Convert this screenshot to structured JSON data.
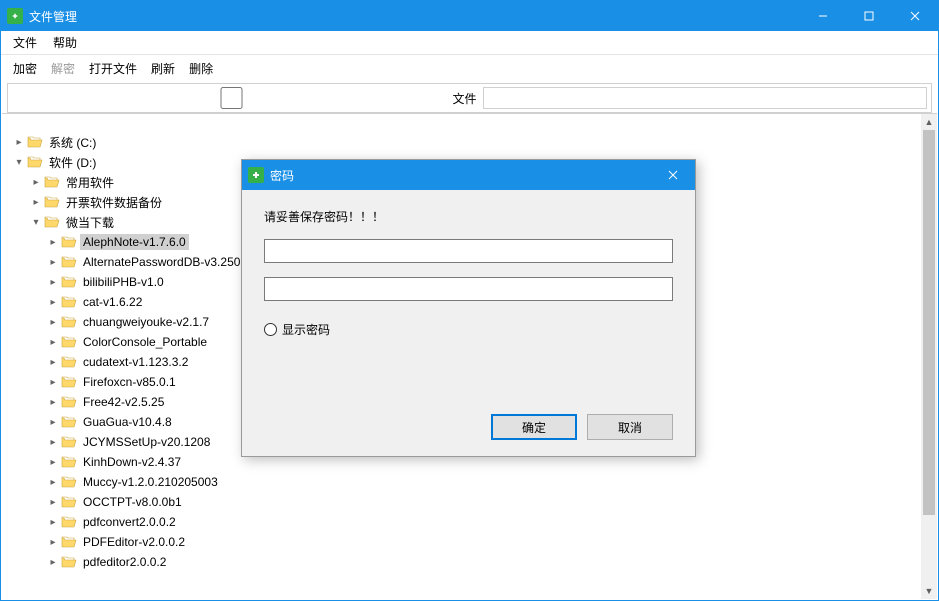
{
  "app": {
    "title": "文件管理"
  },
  "menubar": {
    "file": "文件",
    "help": "帮助"
  },
  "toolbar": {
    "encrypt": "加密",
    "decrypt": "解密",
    "open_file": "打开文件",
    "refresh": "刷新",
    "delete": "删除"
  },
  "fieldrow": {
    "label": "文件"
  },
  "tree": {
    "drive_c": "系统 (C:)",
    "drive_d": "软件 (D:)",
    "d_children": {
      "common": "常用软件",
      "backup": "开票软件数据备份",
      "weidown": "微当下载",
      "weidown_items": [
        "AlephNote-v1.7.6.0",
        "AlternatePasswordDB-v3.250",
        "bilibiliPHB-v1.0",
        "cat-v1.6.22",
        "chuangweiyouke-v2.1.7",
        "ColorConsole_Portable",
        "cudatext-v1.123.3.2",
        "Firefoxcn-v85.0.1",
        "Free42-v2.5.25",
        "GuaGua-v10.4.8",
        "JCYMSSetUp-v20.1208",
        "KinhDown-v2.4.37",
        "Muccy-v1.2.0.210205003",
        "OCCTPT-v8.0.0b1",
        "pdfconvert2.0.0.2",
        "PDFEditor-v2.0.0.2",
        "pdfeditor2.0.0.2"
      ]
    }
  },
  "dialog": {
    "title": "密码",
    "message": "请妥善保存密码！！！",
    "show_password": "显示密码",
    "ok": "确定",
    "cancel": "取消"
  }
}
